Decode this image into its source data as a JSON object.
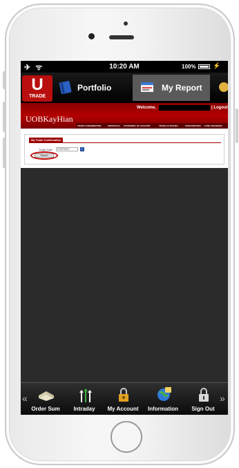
{
  "status_bar": {
    "left_icons": "✈ ᯤ",
    "time": "10:20 AM",
    "battery": "100%"
  },
  "app_nav": {
    "logo_letter": "U",
    "logo_text": "TRADE",
    "tabs": [
      {
        "label": "Portfolio",
        "icon": "notebook-icon"
      },
      {
        "label": "My Report",
        "icon": "report-icon"
      }
    ]
  },
  "web": {
    "brand": "UOBKayHian",
    "welcome": "Welcome,",
    "logout": "| Logout",
    "menu": [
      "TRADE CONFIRMATION",
      "PORTFOLIO",
      "STATEMENT OF ACCOUNT",
      "TRADE ACTIVITIES",
      "SUBSCRIPTION",
      "FUND TRANSFER"
    ],
    "panel_title": "My Trade Confirmation",
    "date_label": "Trade Date",
    "date_value": "07/07/2017",
    "search_button": "Search"
  },
  "toolbar": {
    "items": [
      {
        "label": "Order Sum",
        "icon": "order-summary-icon"
      },
      {
        "label": "Intraday",
        "icon": "intraday-icon"
      },
      {
        "label": "My Account",
        "icon": "my-account-icon"
      },
      {
        "label": "Information",
        "icon": "information-icon"
      },
      {
        "label": "Sign Out",
        "icon": "sign-out-icon"
      }
    ],
    "prev_arrow": "«",
    "next_arrow": "»"
  },
  "colors": {
    "brand_red": "#b40000",
    "selected_tab": "#5a5a5a",
    "screen_bg": "#2b2b2b"
  }
}
